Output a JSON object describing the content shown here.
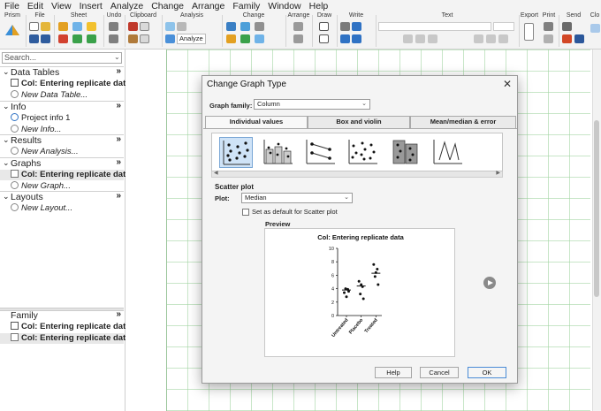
{
  "menu": [
    "File",
    "Edit",
    "View",
    "Insert",
    "Analyze",
    "Change",
    "Arrange",
    "Family",
    "Window",
    "Help"
  ],
  "ribbon": {
    "groups": [
      "Prism",
      "File",
      "Sheet",
      "Undo",
      "Clipboard",
      "Analysis",
      "Change",
      "Arrange",
      "Draw",
      "Write",
      "Text",
      "Export",
      "Print",
      "Send",
      "Clo"
    ],
    "analyze_label": "Analyze",
    "accent": "#2f72c4"
  },
  "sidebar": {
    "search_placeholder": "Search...",
    "sections": {
      "data_tables": {
        "title": "Data Tables",
        "items": [
          "Col: Entering replicate data",
          "New Data Table..."
        ]
      },
      "info": {
        "title": "Info",
        "items": [
          "Project info 1",
          "New Info..."
        ]
      },
      "results": {
        "title": "Results",
        "items": [
          "New Analysis..."
        ]
      },
      "graphs": {
        "title": "Graphs",
        "items": [
          "Col: Entering replicate data",
          "New Graph..."
        ]
      },
      "layouts": {
        "title": "Layouts",
        "items": [
          "New Layout..."
        ]
      }
    },
    "family": {
      "title": "Family",
      "items": [
        "Col: Entering replicate data",
        "Col: Entering replicate data"
      ]
    }
  },
  "dialog": {
    "title": "Change Graph Type",
    "graph_family_label": "Graph family:",
    "graph_family_value": "Column",
    "tabs": [
      "Individual values",
      "Box and violin",
      "Mean/median & error"
    ],
    "selected_type": "Scatter plot",
    "plot_label": "Plot:",
    "plot_value": "Median",
    "default_checkbox_label": "Set as default for Scatter plot",
    "preview_label": "Preview",
    "buttons": {
      "help": "Help",
      "cancel": "Cancel",
      "ok": "OK"
    }
  },
  "chart_data": {
    "type": "scatter",
    "title": "Col: Entering replicate data",
    "categories": [
      "Untreated",
      "Placebo",
      "Treated"
    ],
    "points": [
      [
        3.4,
        3.9,
        4.0,
        3.6,
        2.8
      ],
      [
        5.1,
        4.3,
        3.2,
        2.5,
        4.6
      ],
      [
        7.6,
        6.9,
        5.8,
        4.6,
        6.4
      ]
    ],
    "medians": [
      3.8,
      4.4,
      6.3
    ],
    "ylim": [
      0,
      10
    ],
    "yticks": [
      0,
      2,
      4,
      6,
      8,
      10
    ],
    "xlabel": "",
    "ylabel": ""
  }
}
